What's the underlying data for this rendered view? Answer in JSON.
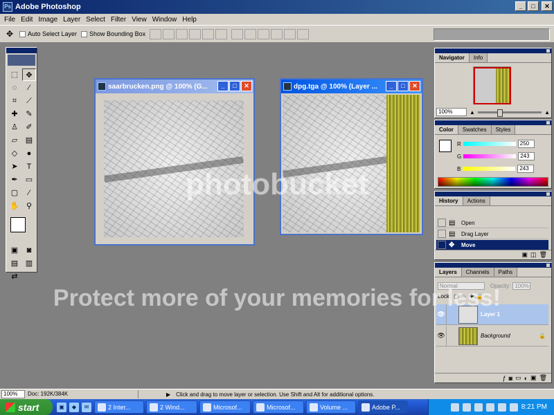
{
  "window": {
    "title": "Adobe Photoshop",
    "min": "_",
    "max": "□",
    "close": "✕"
  },
  "menu": [
    "File",
    "Edit",
    "Image",
    "Layer",
    "Select",
    "Filter",
    "View",
    "Window",
    "Help"
  ],
  "options": {
    "auto_select": "Auto Select Layer",
    "bounding_box": "Show Bounding Box"
  },
  "docs": [
    {
      "title": "saarbrucken.png @ 100% (G..."
    },
    {
      "title": "dpg.tga @ 100% (Layer ..."
    }
  ],
  "navigator": {
    "tabs": [
      "Navigator",
      "Info"
    ],
    "zoom": "100%"
  },
  "color": {
    "tabs": [
      "Color",
      "Swatches",
      "Styles"
    ],
    "rows": [
      {
        "label": "R",
        "value": "250",
        "color": "#00c8c8"
      },
      {
        "label": "G",
        "value": "243",
        "color": "#c800c8"
      },
      {
        "label": "B",
        "value": "243",
        "color": "#c8c800"
      }
    ]
  },
  "history": {
    "tabs": [
      "History",
      "Actions"
    ],
    "items": [
      "Open",
      "Drag Layer",
      "Move"
    ]
  },
  "layers": {
    "tabs": [
      "Layers",
      "Channels",
      "Paths"
    ],
    "blend": "Normal",
    "opacity_label": "Opacity:",
    "opacity": "100%",
    "lock_label": "Lock:",
    "rows": [
      "Layer 1",
      "Background"
    ]
  },
  "status": {
    "zoom": "100%",
    "doc": "Doc: 192K/384K",
    "hint": "Click and drag to move layer or selection.  Use Shift and Alt for additional options."
  },
  "taskbar": {
    "start": "start",
    "tasks": [
      "2 Inter...",
      "2 Wind...",
      "Microsof...",
      "Microsof...",
      "Volume ...",
      "Adobe P..."
    ],
    "clock": "8:21 PM"
  },
  "watermark": {
    "brand": "photobucket",
    "message": "Protect more of your memories for less!"
  }
}
